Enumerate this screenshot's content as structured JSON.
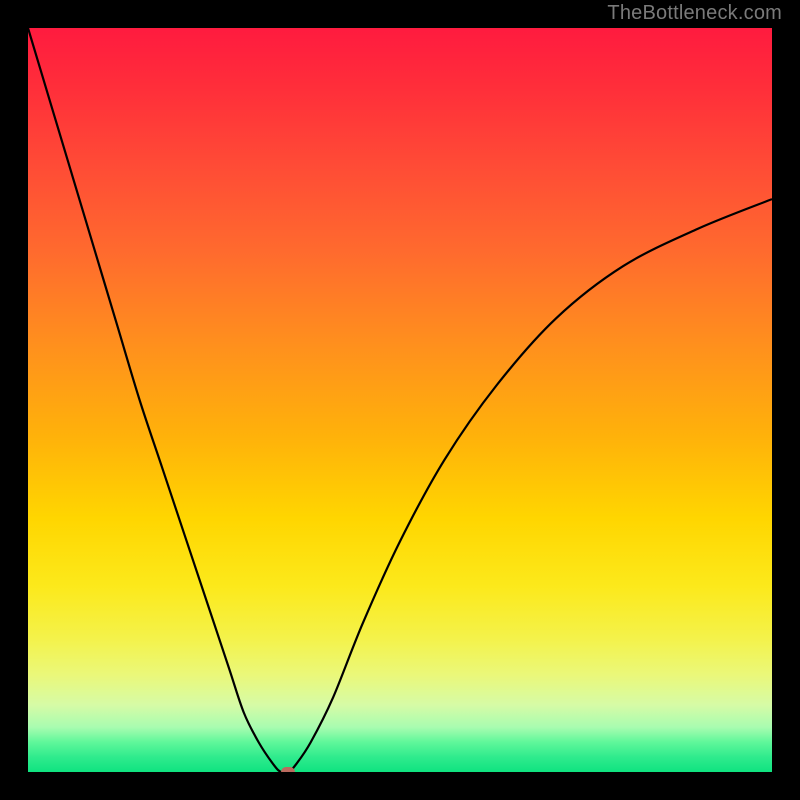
{
  "attribution": "TheBottleneck.com",
  "chart_data": {
    "type": "line",
    "title": "",
    "xlabel": "",
    "ylabel": "",
    "xlim": [
      0,
      100
    ],
    "ylim": [
      0,
      100
    ],
    "gradient_stops": [
      {
        "pct": 0,
        "color": "#ff1b3f"
      },
      {
        "pct": 18,
        "color": "#ff4a36"
      },
      {
        "pct": 42,
        "color": "#ff8e1e"
      },
      {
        "pct": 66,
        "color": "#ffd600"
      },
      {
        "pct": 87,
        "color": "#eaf87a"
      },
      {
        "pct": 100,
        "color": "#0fe380"
      }
    ],
    "series": [
      {
        "name": "bottleneck-curve",
        "x": [
          0,
          3,
          6,
          9,
          12,
          15,
          18,
          21,
          24,
          27,
          29,
          31,
          33,
          34,
          35,
          36,
          38,
          41,
          45,
          50,
          56,
          63,
          71,
          80,
          90,
          100
        ],
        "y": [
          100,
          90,
          80,
          70,
          60,
          50,
          41,
          32,
          23,
          14,
          8,
          4,
          1,
          0,
          0,
          1,
          4,
          10,
          20,
          31,
          42,
          52,
          61,
          68,
          73,
          77
        ]
      }
    ],
    "marker": {
      "x": 35,
      "y": 0,
      "color": "#bb6a5e"
    }
  }
}
